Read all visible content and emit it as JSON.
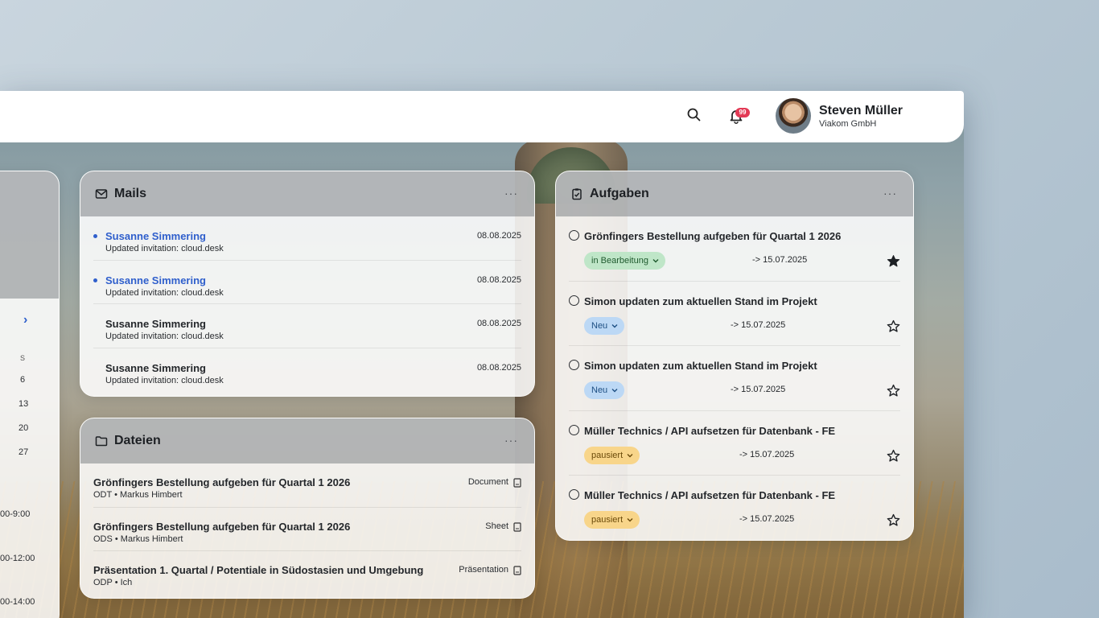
{
  "user": {
    "name": "Steven Müller",
    "company": "Viakom GmbH"
  },
  "notifications": {
    "count": "99"
  },
  "calendar": {
    "weekday": "S",
    "days": [
      "6",
      "13",
      "20",
      "27"
    ],
    "slots": [
      "00-9:00",
      "00-12:00",
      "00-14:00"
    ]
  },
  "mails": {
    "title": "Mails",
    "items": [
      {
        "from": "Susanne Simmering",
        "subject": "Updated invitation: cloud.desk",
        "date": "08.08.2025",
        "unread": true
      },
      {
        "from": "Susanne Simmering",
        "subject": "Updated invitation: cloud.desk",
        "date": "08.08.2025",
        "unread": true
      },
      {
        "from": "Susanne Simmering",
        "subject": "Updated invitation: cloud.desk",
        "date": "08.08.2025",
        "unread": false
      },
      {
        "from": "Susanne Simmering",
        "subject": "Updated invitation: cloud.desk",
        "date": "08.08.2025",
        "unread": false
      }
    ]
  },
  "files": {
    "title": "Dateien",
    "items": [
      {
        "name": "Grönfingers Bestellung aufgeben für Quartal 1 2026",
        "meta": "ODT • Markus Himbert",
        "type": "Document"
      },
      {
        "name": "Grönfingers Bestellung aufgeben für Quartal 1 2026",
        "meta": "ODS • Markus Himbert",
        "type": "Sheet"
      },
      {
        "name": "Präsentation 1. Quartal / Potentiale in Südostasien und Umgebung",
        "meta": "ODP • Ich",
        "type": "Präsentation"
      }
    ]
  },
  "tasks": {
    "title": "Aufgaben",
    "items": [
      {
        "title": "Grönfingers Bestellung aufgeben für Quartal 1 2026",
        "status": "in Bearbeitung",
        "status_color": "green",
        "due": "-> 15.07.2025",
        "starred": true
      },
      {
        "title": "Simon updaten zum aktuellen Stand im Projekt",
        "status": "Neu",
        "status_color": "blue",
        "due": "-> 15.07.2025",
        "starred": false
      },
      {
        "title": "Simon updaten zum aktuellen Stand im Projekt",
        "status": "Neu",
        "status_color": "blue",
        "due": "-> 15.07.2025",
        "starred": false
      },
      {
        "title": "Müller Technics / API aufsetzen für Datenbank - FE",
        "status": "pausiert",
        "status_color": "orange",
        "due": "-> 15.07.2025",
        "starred": false
      },
      {
        "title": "Müller Technics / API aufsetzen für Datenbank - FE",
        "status": "pausiert",
        "status_color": "orange",
        "due": "-> 15.07.2025",
        "starred": false
      }
    ]
  },
  "more_label": "···",
  "colors": {
    "accent": "#2f5fcc",
    "badge": "#e33a55"
  }
}
